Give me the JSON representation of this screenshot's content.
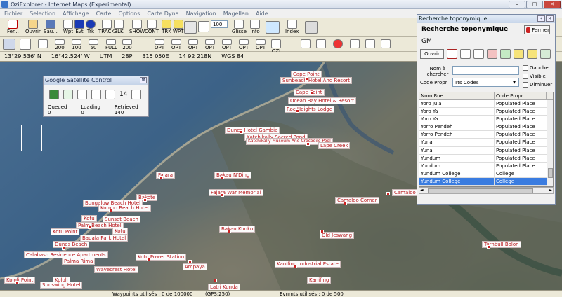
{
  "window": {
    "title": "OziExplorer - Internet Maps (Experimental)",
    "btn_min": "–",
    "btn_max": "□",
    "btn_close": "✕"
  },
  "menu": [
    "Fichier",
    "Selection",
    "Affichage",
    "Carte",
    "Options",
    "Carte Dyna",
    "Navigation",
    "Magellan",
    "Aide"
  ],
  "toolbar": {
    "fer": "Fer...",
    "ouvrir": "Ouvrir",
    "sau": "Sau...",
    "zoom_value": "100",
    "glisse": "Glisse",
    "info": "Info",
    "index": "Index",
    "icon_labels": [
      "Wpt",
      "Evt",
      "Trk",
      "TRACK",
      "BLK",
      "SHOW",
      "CONT",
      "TRK",
      "WPT",
      "OZI"
    ]
  },
  "toolbar2_labels": [
    "200",
    "100",
    "50",
    "FULL",
    "200",
    "OPT",
    "OPT",
    "OPT",
    "OPT",
    "OPT",
    "OPT",
    "OPT"
  ],
  "status": {
    "lat": "13°29.536' N",
    "lon": "16°42.524' W",
    "utm_label": "UTM",
    "utm_zone": "28P",
    "easting": "315 050E",
    "northing": "14 92 218N",
    "datum": "WGS 84"
  },
  "satellite_control": {
    "title": "Google Satellite Control",
    "close": "⊠",
    "zoom": "14",
    "queued_label": "Queued",
    "queued_value": "0",
    "loading_label": "Loading",
    "loading_value": "0",
    "retrieved_label": "Retrieved",
    "retrieved_value": "140"
  },
  "search_panel": {
    "title": "Recherche toponymique",
    "heading": "Recherche toponymique",
    "fermer": "Fermer",
    "db_name": "GM",
    "ouvrir": "Ouvrir",
    "nom_label": "Nom à chercher",
    "nom_value": "",
    "code_label": "Code Propr",
    "code_value": "Tts Codes",
    "checkboxes": [
      "Gauche",
      "Visible",
      "Diminuer"
    ],
    "columns": [
      "Nom Rue",
      "Code Propr"
    ],
    "rows": [
      [
        "Yoro Jula",
        "Populated Place"
      ],
      [
        "Yoro Ya",
        "Populated Place"
      ],
      [
        "Yoro Ya",
        "Populated Place"
      ],
      [
        "Yorro Pendeh",
        "Populated Place"
      ],
      [
        "Yorro Pendeh",
        "Populated Place"
      ],
      [
        "Yuna",
        "Populated Place"
      ],
      [
        "Yuna",
        "Populated Place"
      ],
      [
        "Yundum",
        "Populated Place"
      ],
      [
        "Yundum",
        "Populated Place"
      ],
      [
        "Yundum College",
        "College"
      ],
      [
        "Yundum College",
        "College"
      ]
    ],
    "selected_row": 10,
    "row_partial": [
      "Yoro Ya",
      "Populated Place"
    ],
    "hscroll_left": "◄",
    "hscroll_right": "►"
  },
  "map_labels": [
    "Cape Point",
    "Sunbeach Hotel And Resort",
    "Cape Point",
    "Ocean Bay Hotel & Resort",
    "Roc Heights Lodge",
    "Dunes Hotel Gambia",
    "Katchikally Sacred Pond",
    "Katchikally Museum And Crocodile Pool",
    "Lape Creek",
    "Fajara",
    "Bakau N'Ding",
    "Fajara War Memorial",
    "Bakote",
    "Bungalow Beach Hotel",
    "Kombo Beach Hotel",
    "Kotu",
    "Sunset Beach",
    "Palm Beach Hotel",
    "Kotu Point",
    "Kotu",
    "Badala Park Hotel",
    "Bakau Kunku",
    "Old Jeswang",
    "Camaloo Corner",
    "Camaloo",
    "Turnbull Bolon",
    "Dunes Beach",
    "Calabash Residence Apartments",
    "Palma Rima",
    "Kotu Power Station",
    "Ampaya",
    "Wavecrest Hotel",
    "Kanifing Industrial Estate",
    "Kololi Point",
    "Kololi",
    "Sunswing Hotel",
    "Latri Kunda",
    "Kanifing"
  ],
  "bottom": {
    "waypoints": "Waypoints utilisés : 0 de 100000",
    "gps": "(GPS:250)",
    "events": "Evnmts utilisés : 0 de 500"
  }
}
